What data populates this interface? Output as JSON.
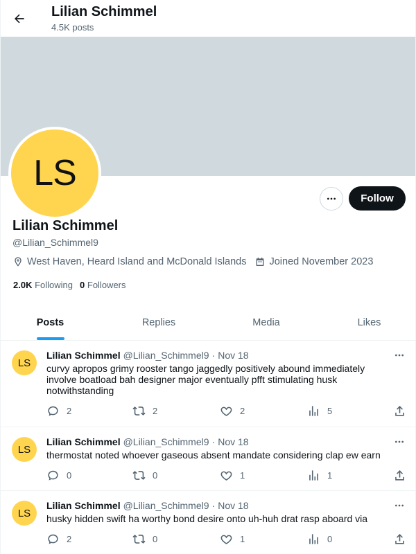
{
  "colors": {
    "banner": "#cfd9de",
    "avatar_bg": "#ffd54f",
    "accent": "#1d9bf0"
  },
  "header": {
    "title": "Lilian Schimmel",
    "posts_count": "4.5K posts",
    "back_icon": "arrow-left-icon"
  },
  "profile": {
    "initials": "LS",
    "name": "Lilian Schimmel",
    "handle": "@Lilian_Schimmel9",
    "location": "West Haven, Heard Island and McDonald Islands",
    "joined": "Joined November 2023",
    "following_count": "2.0K",
    "following_label": "Following",
    "followers_count": "0",
    "followers_label": "Followers",
    "follow_label": "Follow"
  },
  "tabs": [
    {
      "label": "Posts",
      "active": true
    },
    {
      "label": "Replies",
      "active": false
    },
    {
      "label": "Media",
      "active": false
    },
    {
      "label": "Likes",
      "active": false
    }
  ],
  "posts": [
    {
      "initials": "LS",
      "name": "Lilian Schimmel",
      "handle": "@Lilian_Schimmel9",
      "dot": "·",
      "time": "Nov 18",
      "text": "curvy apropos grimy rooster tango jaggedly positively abound immediately involve boatload bah designer major eventually pfft stimulating husk notwithstanding",
      "replies": "2",
      "reposts": "2",
      "likes": "2",
      "views": "5"
    },
    {
      "initials": "LS",
      "name": "Lilian Schimmel",
      "handle": "@Lilian_Schimmel9",
      "dot": "·",
      "time": "Nov 18",
      "text": "thermostat noted whoever gaseous absent mandate considering clap ew earn",
      "replies": "0",
      "reposts": "0",
      "likes": "1",
      "views": "1"
    },
    {
      "initials": "LS",
      "name": "Lilian Schimmel",
      "handle": "@Lilian_Schimmel9",
      "dot": "·",
      "time": "Nov 18",
      "text": "husky hidden swift ha worthy bond desire onto uh-huh drat rasp aboard via",
      "replies": "2",
      "reposts": "0",
      "likes": "1",
      "views": "0"
    }
  ]
}
